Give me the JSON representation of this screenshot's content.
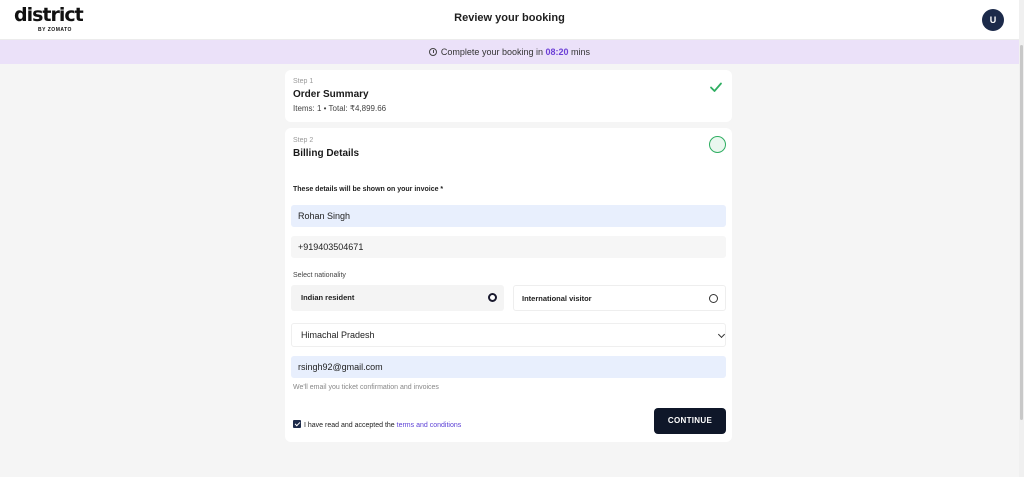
{
  "header": {
    "logo_text": "district",
    "logo_sub": "BY ZOMATO",
    "title": "Review your booking",
    "avatar_initial": "U"
  },
  "timer": {
    "prefix": "Complete your booking in",
    "time": "08:20",
    "suffix": "mins"
  },
  "steps": [
    {
      "label": "Step 1",
      "title": "Order Summary",
      "meta": "Items: 1 • Total: ₹4,899.66",
      "status": "complete"
    },
    {
      "label": "Step 2",
      "title": "Billing Details",
      "status": "in-progress"
    }
  ],
  "billing": {
    "note": "These details will be shown on your invoice *",
    "name_value": "Rohan Singh",
    "phone_value": "+919403504671",
    "nationality_label": "Select nationality",
    "nationality_options": [
      {
        "label": "Indian resident",
        "selected": true
      },
      {
        "label": "International visitor",
        "selected": false
      }
    ],
    "state_value": "Himachal Pradesh",
    "email_value": "rsingh92@gmail.com",
    "email_hint": "We'll email you ticket confirmation and invoices",
    "terms_prefix": "I have read and accepted the",
    "terms_link": "terms and conditions",
    "terms_checked": true,
    "continue_label": "CONTINUE"
  },
  "colors": {
    "accent": "#6c3fd6",
    "timer_bg": "#ebe1f9",
    "button_bg": "#0f1729",
    "success": "#2fae62"
  }
}
